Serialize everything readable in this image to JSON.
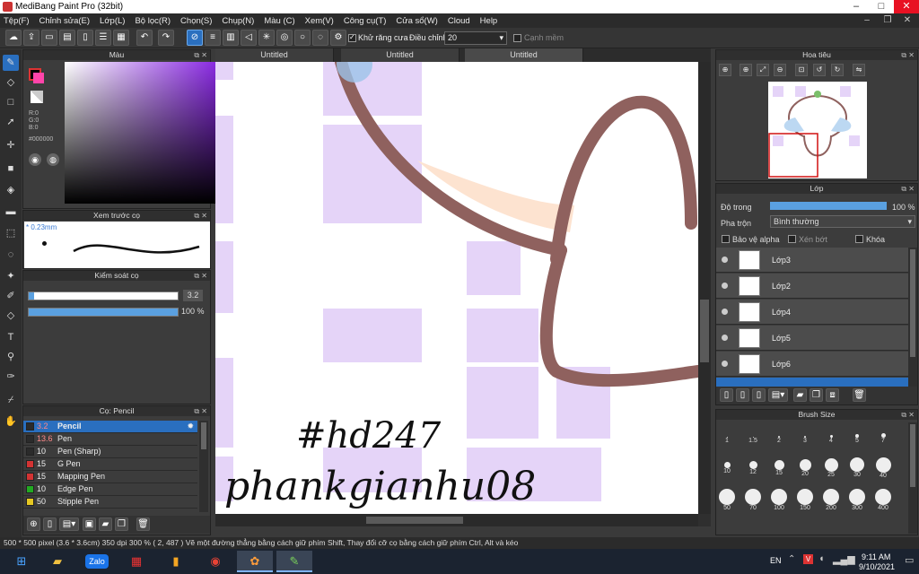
{
  "window": {
    "title": "MediBang Paint Pro (32bit)"
  },
  "menu": [
    "Tệp(F)",
    "Chỉnh sửa(E)",
    "Lớp(L)",
    "Bộ lọc(R)",
    "Chọn(S)",
    "Chụp(N)",
    "Màu (C)",
    "Xem(V)",
    "Công cụ(T)",
    "Cửa sổ(W)",
    "Cloud",
    "Help"
  ],
  "toolbar": {
    "antialias_label": "Khử răng cưa",
    "adjust_label": "Điều chỉnh",
    "adjust_value": "20",
    "smooth_label": "Cạnh mềm"
  },
  "color_panel": {
    "title": "Màu",
    "r": "R:0",
    "g": "G:0",
    "b": "B:0",
    "hex": "#000000",
    "colors": {
      "fg": "#000000",
      "bg": "#ffffff",
      "hue": "#8a2be2"
    }
  },
  "brush_preview": {
    "title": "Xem trước cọ",
    "size": "* 0.23mm"
  },
  "brush_control": {
    "title": "Kiểm soát cọ",
    "size_value": "3.2",
    "opacity_value": "100 %"
  },
  "brush_list": {
    "title": "Cọ: Pencil",
    "items": [
      {
        "size": "3.2",
        "name": "Pencil",
        "color": "#2b2b2b"
      },
      {
        "size": "13.6",
        "name": "Pen",
        "color": "#2b2b2b"
      },
      {
        "size": "10",
        "name": "Pen (Sharp)",
        "color": "#2b2b2b"
      },
      {
        "size": "15",
        "name": "G Pen",
        "color": "#d33333"
      },
      {
        "size": "15",
        "name": "Mapping Pen",
        "color": "#d33333"
      },
      {
        "size": "10",
        "name": "Edge Pen",
        "color": "#22aa22"
      },
      {
        "size": "50",
        "name": "Stipple Pen",
        "color": "#e6c822"
      }
    ]
  },
  "tabs": [
    "Untitled",
    "Untitled",
    "Untitled"
  ],
  "canvas": {
    "watermark_line1": "#hd247",
    "watermark_line2": "phankgianhu08"
  },
  "navigator": {
    "title": "Hoa tiêu"
  },
  "layers": {
    "title": "Lớp",
    "opacity_label": "Độ trong",
    "opacity_value": "100 %",
    "blend_label": "Pha trộn",
    "blend_value": "Bình thường",
    "protect_alpha": "Bảo vệ alpha",
    "clipping": "Xén bớt",
    "lock": "Khóa",
    "items": [
      "Lớp3",
      "Lớp2",
      "Lớp4",
      "Lớp5",
      "Lớp6"
    ]
  },
  "brush_size": {
    "title": "Brush Size",
    "sizes": [
      "1",
      "1.5",
      "2",
      "3",
      "4",
      "5",
      "7",
      "10",
      "12",
      "15",
      "20",
      "25",
      "30",
      "40",
      "50",
      "70",
      "100",
      "150",
      "200",
      "300",
      "400"
    ]
  },
  "status": {
    "info": "500 * 500 pixel  (3.6 * 3.6cm)  350 dpi  300 %  ( 2, 487 )  Vẽ một đường thẳng bằng cách giữ phím Shift, Thay đổi cỡ cọ bằng cách giữ phím Ctrl, Alt và kéo"
  },
  "taskbar": {
    "lang": "EN",
    "time": "9:11 AM",
    "date": "9/10/2021"
  }
}
